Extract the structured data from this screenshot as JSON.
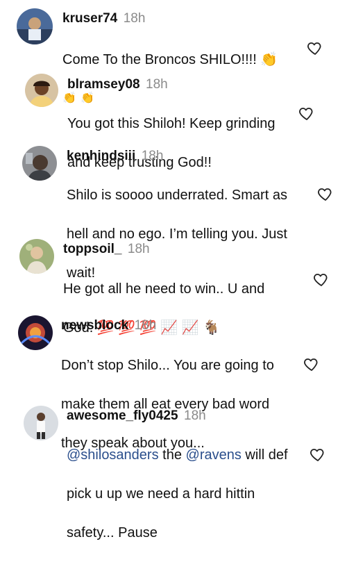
{
  "comments": [
    {
      "username": "kruser74",
      "time": "18h",
      "text_lines": [
        "Come To the Broncos SHILO!!!! 👏",
        "👏 👏"
      ]
    },
    {
      "username": "blramsey08",
      "time": "18h",
      "text_lines": [
        "You got this Shiloh! Keep grinding",
        "and keep trusting God!!"
      ]
    },
    {
      "username": "kenhindsiii",
      "time": "18h",
      "text_lines": [
        "Shilo is soooo underrated. Smart as",
        "hell and no ego. I’m telling you. Just",
        "wait!"
      ]
    },
    {
      "username": "toppsoil_",
      "time": "18h",
      "text_lines": [
        "He got all he need to win.. U and",
        "God. 💯 💯 💯 📈 📈 🐐"
      ]
    },
    {
      "username": "newsblock",
      "time": "18h",
      "text_lines": [
        "Don’t stop Shilo... You are going to",
        "make them all eat every bad word",
        "they speak about you..."
      ]
    },
    {
      "username": "awesome_fly0425",
      "time": "18h",
      "mention_1": "@shilosanders",
      "mid_text": " the ",
      "mention_2": "@ravens",
      "end_text": " will def",
      "text_lines": [
        "pick u up we need a hard hittin",
        "safety... Pause"
      ]
    }
  ],
  "icons": {
    "like": "heart-outline-icon"
  },
  "colors": {
    "mention": "#2a4e8c",
    "timestamp": "#8a8a8a",
    "heart_stroke": "#222222"
  }
}
